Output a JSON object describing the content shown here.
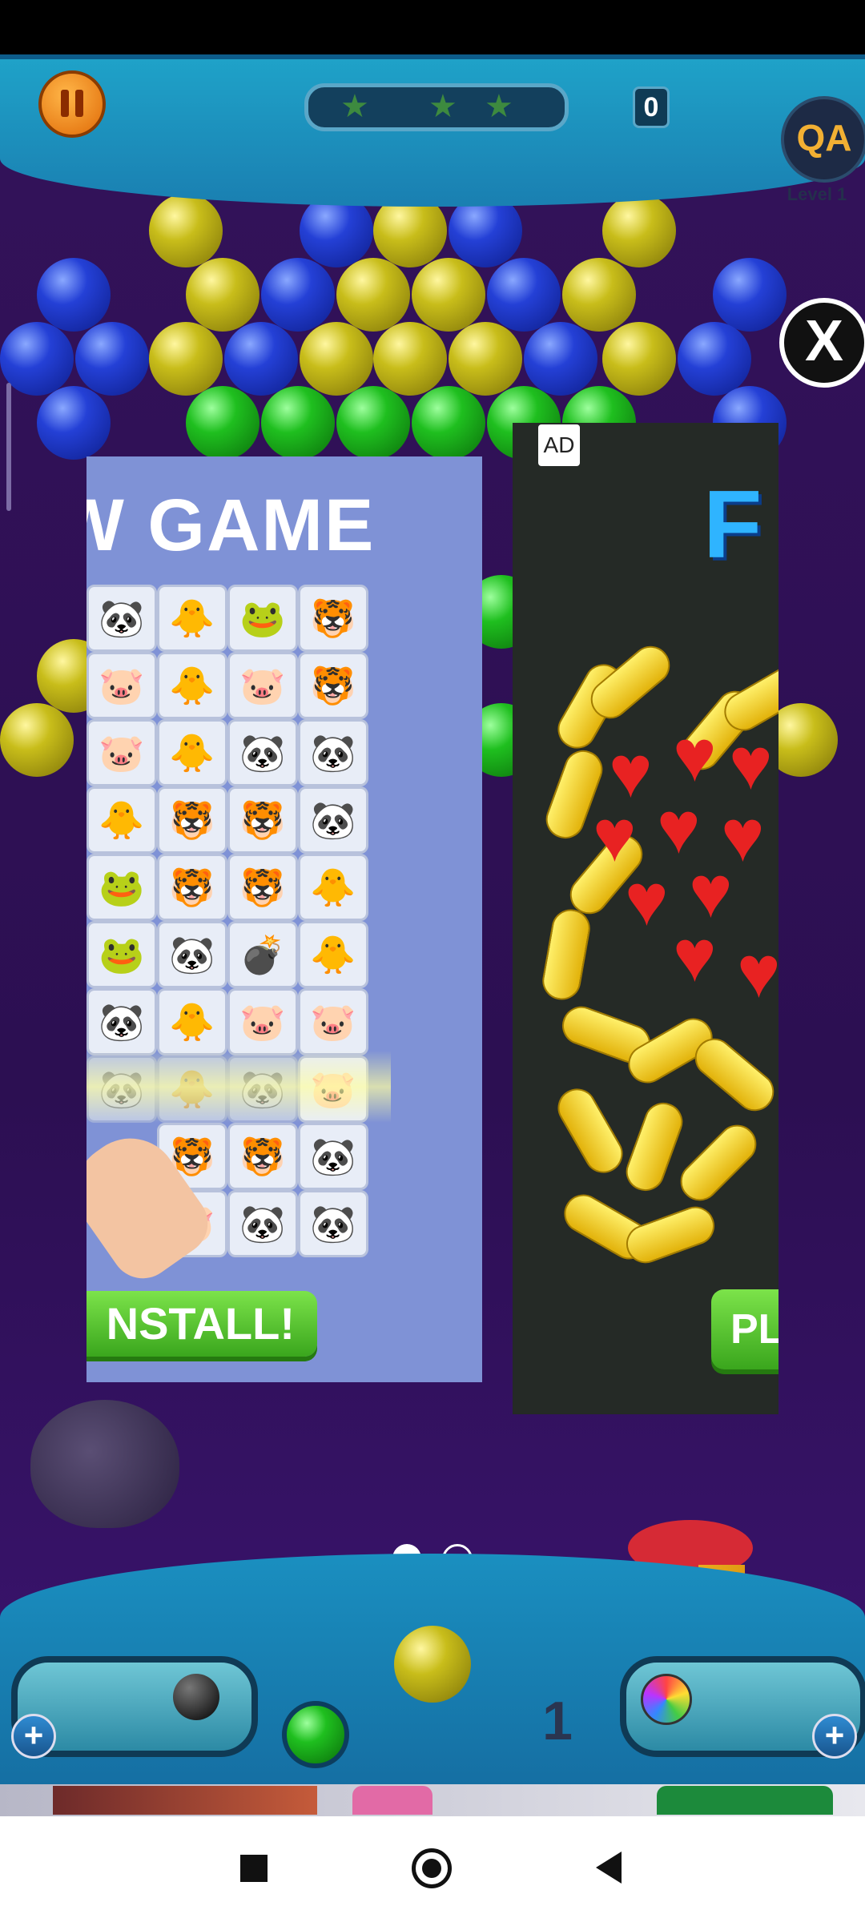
{
  "hud": {
    "pause_icon": "pause-icon",
    "stars_earned": 0,
    "stars_total": 3,
    "score": "0",
    "avatar_initials": "QA",
    "level_label": "Level 1"
  },
  "ad_overlay": {
    "close_label": "X",
    "ad_badge": "AD",
    "card1": {
      "title": "W GAME",
      "install_label": "NSTALL!"
    },
    "card2": {
      "title": "F",
      "play_label": "PL"
    },
    "pager": {
      "pages": 2,
      "active": 1
    }
  },
  "bottom": {
    "next_bubble_count": "1",
    "left_booster": "bomb-icon",
    "right_booster": "rainbow-ball-icon",
    "add_label": "+"
  },
  "colors": {
    "bubble_blue": "#2440d6",
    "bubble_yellow": "#c8bd1a",
    "bubble_green": "#1fbf1f",
    "ad1_bg": "#7f92d6",
    "ad2_bg": "#252a26",
    "cta_green": "#3aa61d"
  }
}
